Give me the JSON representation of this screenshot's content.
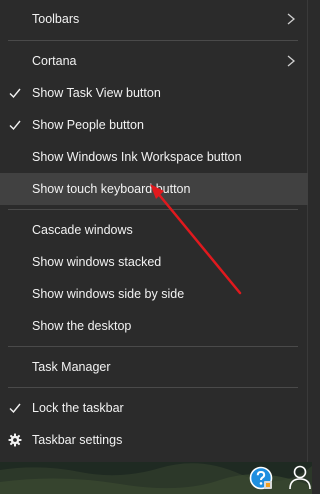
{
  "context_menu": {
    "items": [
      {
        "label": "Toolbars",
        "checked": false,
        "submenu": true
      },
      {
        "label": "Cortana",
        "checked": false,
        "submenu": true
      },
      {
        "label": "Show Task View button",
        "checked": true,
        "submenu": false
      },
      {
        "label": "Show People button",
        "checked": true,
        "submenu": false
      },
      {
        "label": "Show Windows Ink Workspace button",
        "checked": false,
        "submenu": false
      },
      {
        "label": "Show touch keyboard button",
        "checked": false,
        "submenu": false,
        "highlighted": true
      },
      {
        "label": "Cascade windows",
        "checked": false,
        "submenu": false
      },
      {
        "label": "Show windows stacked",
        "checked": false,
        "submenu": false
      },
      {
        "label": "Show windows side by side",
        "checked": false,
        "submenu": false
      },
      {
        "label": "Show the desktop",
        "checked": false,
        "submenu": false
      },
      {
        "label": "Task Manager",
        "checked": false,
        "submenu": false
      },
      {
        "label": "Lock the taskbar",
        "checked": true,
        "submenu": false
      },
      {
        "label": "Taskbar settings",
        "checked": false,
        "submenu": false,
        "icon": "gear-icon"
      }
    ]
  },
  "taskbar": {
    "icons": [
      "help-icon",
      "people-icon"
    ]
  },
  "annotation": {
    "type": "red-arrow",
    "color": "#e0191e",
    "points_to": "Show touch keyboard button"
  },
  "colors": {
    "menu_bg": "#2b2b2b",
    "menu_text": "#f2f2f2",
    "hover_bg": "#414141",
    "separator": "#4a4a4a",
    "help_blue": "#1e8fe0"
  }
}
